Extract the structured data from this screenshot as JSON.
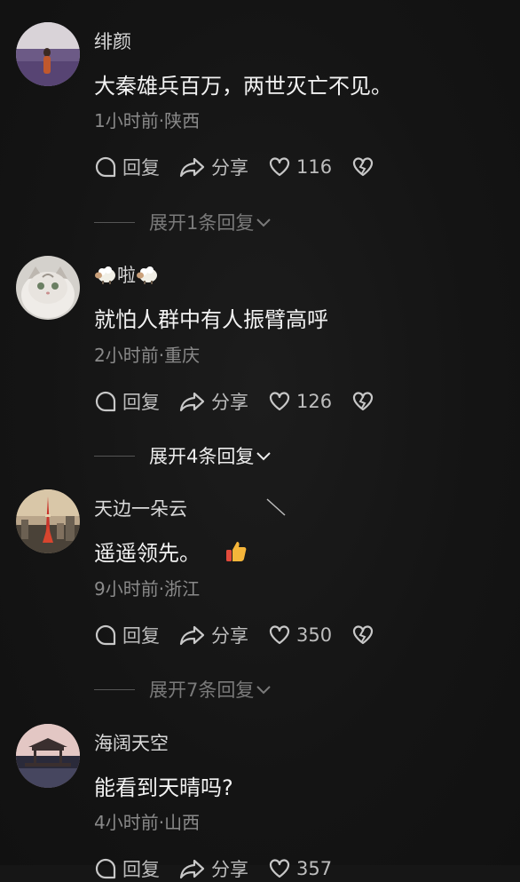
{
  "comments": [
    {
      "user": "绯颜",
      "text": "大秦雄兵百万，两世灭亡不见。",
      "meta": "1小时前·陕西",
      "reply": "回复",
      "share": "分享",
      "likes": "116",
      "expand": "展开1条回复"
    },
    {
      "user_prefix_icon": "sheep-emoji",
      "user": "啦",
      "user_suffix_icon": "sheep-emoji",
      "text": "就怕人群中有人振臂高呼",
      "meta": "2小时前·重庆",
      "reply": "回复",
      "share": "分享",
      "likes": "126",
      "expand": "展开4条回复"
    },
    {
      "user": "天边一朵云",
      "text": "遥遥领先。",
      "text_suffix_icon": "thumbs-up-emoji",
      "meta": "9小时前·浙江",
      "reply": "回复",
      "share": "分享",
      "likes": "350",
      "expand": "展开7条回复"
    },
    {
      "user": "海阔天空",
      "text": "能看到天晴吗?",
      "meta": "4小时前·山西",
      "reply": "回复",
      "share": "分享",
      "likes": "357"
    }
  ],
  "colors": {
    "background": "#161616",
    "text": "#f2f2f2",
    "meta": "#8a8a8a"
  }
}
